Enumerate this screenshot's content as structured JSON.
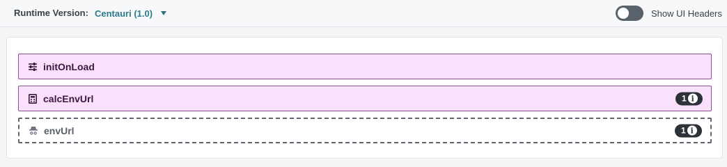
{
  "header": {
    "runtime_label": "Runtime Version:",
    "runtime_value": "Centauri (1.0)",
    "toggle_label": "Show UI Headers",
    "toggle_on": false
  },
  "nodes": [
    {
      "title": "initOnLoad",
      "icon": "sliders-icon",
      "style": "filled",
      "badge": null
    },
    {
      "title": "calcEnvUrl",
      "icon": "calculator-icon",
      "style": "filled",
      "badge": "1"
    },
    {
      "title": "envUrl",
      "icon": "incognito-icon",
      "style": "dashed",
      "badge": "1"
    }
  ],
  "colors": {
    "node_fill": "#f9e1fb",
    "node_border": "#8a4e93",
    "accent_text": "#2c7a8c",
    "badge_bg": "#2d3238"
  }
}
